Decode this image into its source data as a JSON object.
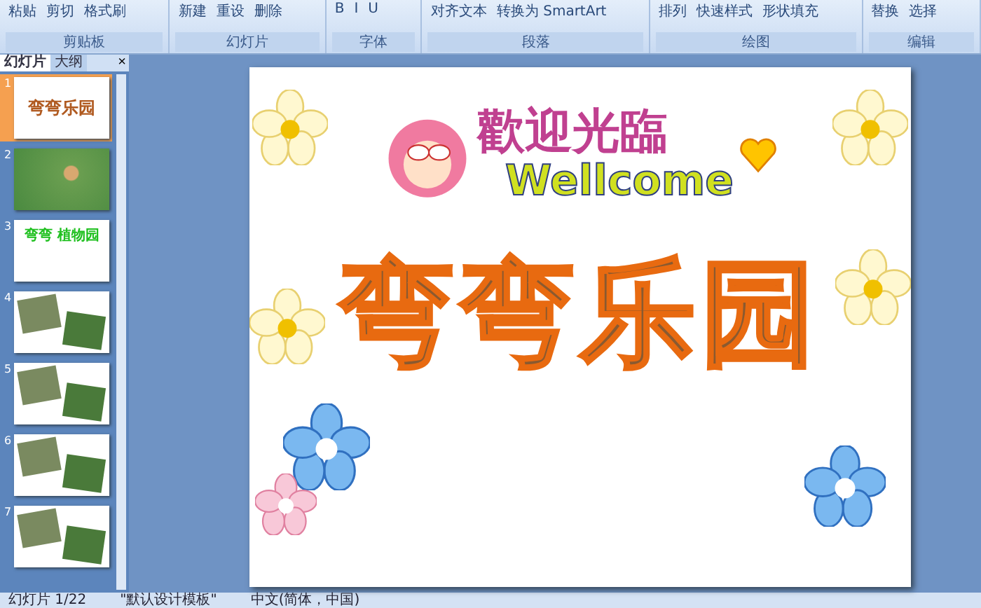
{
  "ribbon": {
    "groups": [
      {
        "label": "剪贴板",
        "buttons": [
          "粘贴",
          "剪切",
          "格式刷"
        ]
      },
      {
        "label": "幻灯片",
        "buttons": [
          "新建",
          "重设",
          "删除"
        ]
      },
      {
        "label": "字体",
        "buttons": [
          "B",
          "I",
          "U"
        ]
      },
      {
        "label": "段落",
        "buttons": [
          "对齐文本",
          "转换为 SmartArt"
        ]
      },
      {
        "label": "绘图",
        "buttons": [
          "排列",
          "快速样式",
          "形状填充"
        ]
      },
      {
        "label": "编辑",
        "buttons": [
          "替换",
          "选择"
        ]
      }
    ]
  },
  "panel": {
    "tabs": [
      {
        "label": "幻灯片",
        "selected": true
      },
      {
        "label": "大纲",
        "selected": false
      }
    ],
    "close": "×",
    "thumbnails": [
      {
        "number": "1",
        "kind": "title",
        "title": "弯弯乐园",
        "selected": true
      },
      {
        "number": "2",
        "kind": "map",
        "selected": false
      },
      {
        "number": "3",
        "kind": "title2",
        "title": "弯弯 植物园",
        "selected": false
      },
      {
        "number": "4",
        "kind": "photos",
        "selected": false
      },
      {
        "number": "5",
        "kind": "photos",
        "selected": false
      },
      {
        "number": "6",
        "kind": "photos",
        "selected": false
      },
      {
        "number": "7",
        "kind": "photos",
        "selected": false
      }
    ]
  },
  "slide": {
    "welcome": "歡迎光臨",
    "welcome_en": "Wellcome",
    "title": "弯弯乐园"
  },
  "status_bar": {
    "slide": "幻灯片 1/22",
    "theme": "\"默认设计模板\"",
    "language": "中文(简体，中国)"
  }
}
